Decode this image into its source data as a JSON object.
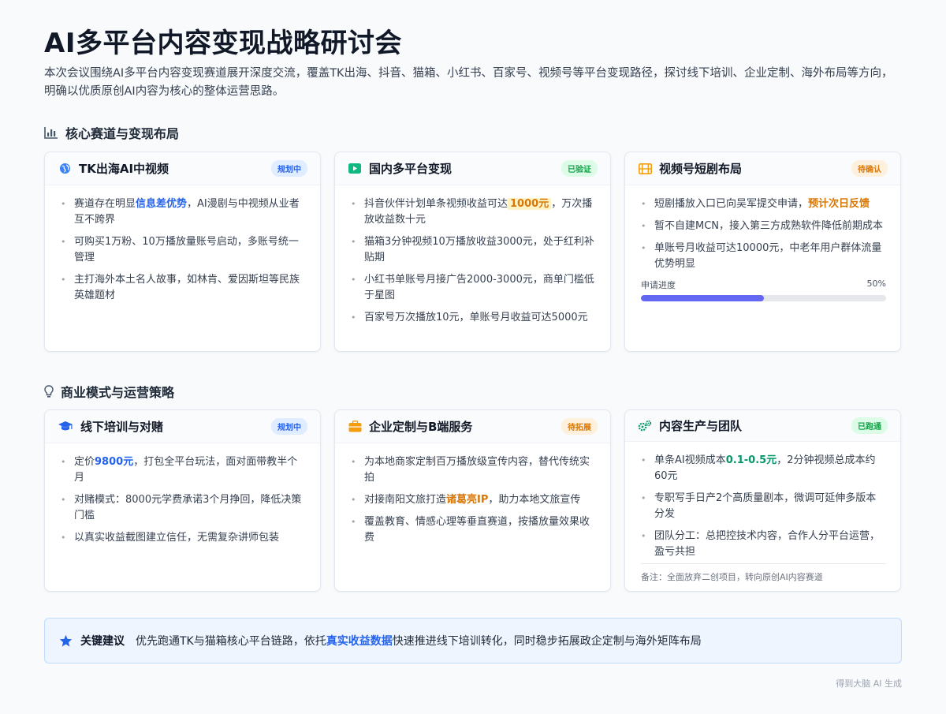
{
  "title": "AI多平台内容变现战略研讨会",
  "subtitle": "本次会议围绕AI多平台内容变现赛道展开深度交流，覆盖TK出海、抖音、猫箱、小红书、百家号、视频号等平台变现路径，探讨线下培训、企业定制、海外布局等方向，明确以优质原创AI内容为核心的整体运营思路。",
  "section1": {
    "title": "核心赛道与变现布局",
    "icon": "bar-chart-icon",
    "cards": [
      {
        "title": "TK出海AI中视频",
        "icon": "globe-icon",
        "badge": "规划中",
        "items": [
          {
            "pre": "赛道存在明显",
            "hl": "信息差优势",
            "post": "，AI漫剧与中视频从业者互不跨界"
          },
          {
            "text": "可购买1万粉、10万播放量账号启动，多账号统一管理"
          },
          {
            "text": "主打海外本土名人故事，如林肯、爱因斯坦等民族英雄题材"
          }
        ]
      },
      {
        "title": "国内多平台变现",
        "icon": "play-icon",
        "badge": "已验证",
        "items": [
          {
            "pre": "抖音伙伴计划单条视频收益可达",
            "hl": "1000元",
            "post": "，万次播放收益数十元"
          },
          {
            "text": "猫箱3分钟视频10万播放收益3000元，处于红利补贴期"
          },
          {
            "text": "小红书单账号月接广告2000-3000元，商单门槛低于星图"
          },
          {
            "text": "百家号万次播放10元，单账号月收益可达5000元"
          }
        ]
      },
      {
        "title": "视频号短剧布局",
        "icon": "film-icon",
        "badge": "待确认",
        "items": [
          {
            "pre": "短剧播放入口已向吴军提交申请，",
            "hl": "预计次日反馈",
            "post": ""
          },
          {
            "text": "暂不自建MCN，接入第三方成熟软件降低前期成本"
          },
          {
            "text": "单账号月收益可达10000元，中老年用户群体流量优势明显"
          }
        ],
        "progress": {
          "label": "申请进度",
          "value_label": "50%",
          "value": 0.5
        }
      }
    ]
  },
  "section2": {
    "title": "商业模式与运营策略",
    "icon": "lightbulb-icon",
    "cards": [
      {
        "title": "线下培训与对赌",
        "icon": "graduation-cap-icon",
        "badge": "规划中",
        "items": [
          {
            "pre": "定价",
            "hl": "9800元",
            "post": "，打包全平台玩法，面对面带教半个月"
          },
          {
            "text": "对赌模式：8000元学费承诺3个月挣回，降低决策门槛"
          },
          {
            "text": "以真实收益截图建立信任，无需复杂讲师包装"
          }
        ]
      },
      {
        "title": "企业定制与B端服务",
        "icon": "briefcase-icon",
        "badge": "待拓展",
        "items": [
          {
            "text": "为本地商家定制百万播放级宣传内容，替代传统实拍"
          },
          {
            "pre": "对接南阳文旅打造",
            "hl": "诸葛亮IP",
            "post": "，助力本地文旅宣传"
          },
          {
            "text": "覆盖教育、情感心理等垂直赛道，按播放量效果收费"
          }
        ]
      },
      {
        "title": "内容生产与团队",
        "icon": "gears-icon",
        "badge": "已跑通",
        "items": [
          {
            "pre": "单条AI视频成本",
            "hl": "0.1-0.5元",
            "post": "，2分钟视频总成本约60元"
          },
          {
            "text": "专职写手日产2个高质量剧本，微调可延伸多版本分发"
          },
          {
            "text": "团队分工：总把控技术内容，合作人分平台运营，盈亏共担"
          }
        ],
        "note": "备注：全面放弃二创项目，转向原创AI内容赛道"
      }
    ]
  },
  "tip": {
    "icon": "star-icon",
    "label": "关键建议",
    "pre": "优先跑通TK与猫箱核心平台链路，依托",
    "hl": "真实收益数据",
    "post": "快速推进线下培训转化，同时稳步拓展政企定制与海外矩阵布局"
  },
  "footer": "得到大脑 AI 生成",
  "colors": {
    "accent_blue": "#2563eb",
    "accent_orange": "#d97706",
    "accent_green": "#059669",
    "progress": "#6366f1"
  }
}
